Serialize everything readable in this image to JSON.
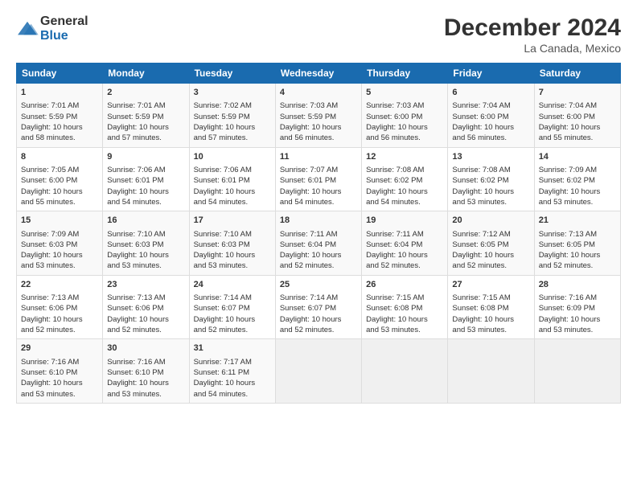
{
  "header": {
    "logo_text_general": "General",
    "logo_text_blue": "Blue",
    "main_title": "December 2024",
    "subtitle": "La Canada, Mexico"
  },
  "columns": [
    "Sunday",
    "Monday",
    "Tuesday",
    "Wednesday",
    "Thursday",
    "Friday",
    "Saturday"
  ],
  "weeks": [
    {
      "days": [
        {
          "num": "1",
          "sunrise": "7:01 AM",
          "sunset": "5:59 PM",
          "daylight": "10 hours and 58 minutes."
        },
        {
          "num": "2",
          "sunrise": "7:01 AM",
          "sunset": "5:59 PM",
          "daylight": "10 hours and 57 minutes."
        },
        {
          "num": "3",
          "sunrise": "7:02 AM",
          "sunset": "5:59 PM",
          "daylight": "10 hours and 57 minutes."
        },
        {
          "num": "4",
          "sunrise": "7:03 AM",
          "sunset": "5:59 PM",
          "daylight": "10 hours and 56 minutes."
        },
        {
          "num": "5",
          "sunrise": "7:03 AM",
          "sunset": "6:00 PM",
          "daylight": "10 hours and 56 minutes."
        },
        {
          "num": "6",
          "sunrise": "7:04 AM",
          "sunset": "6:00 PM",
          "daylight": "10 hours and 56 minutes."
        },
        {
          "num": "7",
          "sunrise": "7:04 AM",
          "sunset": "6:00 PM",
          "daylight": "10 hours and 55 minutes."
        }
      ]
    },
    {
      "days": [
        {
          "num": "8",
          "sunrise": "7:05 AM",
          "sunset": "6:00 PM",
          "daylight": "10 hours and 55 minutes."
        },
        {
          "num": "9",
          "sunrise": "7:06 AM",
          "sunset": "6:01 PM",
          "daylight": "10 hours and 54 minutes."
        },
        {
          "num": "10",
          "sunrise": "7:06 AM",
          "sunset": "6:01 PM",
          "daylight": "10 hours and 54 minutes."
        },
        {
          "num": "11",
          "sunrise": "7:07 AM",
          "sunset": "6:01 PM",
          "daylight": "10 hours and 54 minutes."
        },
        {
          "num": "12",
          "sunrise": "7:08 AM",
          "sunset": "6:02 PM",
          "daylight": "10 hours and 54 minutes."
        },
        {
          "num": "13",
          "sunrise": "7:08 AM",
          "sunset": "6:02 PM",
          "daylight": "10 hours and 53 minutes."
        },
        {
          "num": "14",
          "sunrise": "7:09 AM",
          "sunset": "6:02 PM",
          "daylight": "10 hours and 53 minutes."
        }
      ]
    },
    {
      "days": [
        {
          "num": "15",
          "sunrise": "7:09 AM",
          "sunset": "6:03 PM",
          "daylight": "10 hours and 53 minutes."
        },
        {
          "num": "16",
          "sunrise": "7:10 AM",
          "sunset": "6:03 PM",
          "daylight": "10 hours and 53 minutes."
        },
        {
          "num": "17",
          "sunrise": "7:10 AM",
          "sunset": "6:03 PM",
          "daylight": "10 hours and 53 minutes."
        },
        {
          "num": "18",
          "sunrise": "7:11 AM",
          "sunset": "6:04 PM",
          "daylight": "10 hours and 52 minutes."
        },
        {
          "num": "19",
          "sunrise": "7:11 AM",
          "sunset": "6:04 PM",
          "daylight": "10 hours and 52 minutes."
        },
        {
          "num": "20",
          "sunrise": "7:12 AM",
          "sunset": "6:05 PM",
          "daylight": "10 hours and 52 minutes."
        },
        {
          "num": "21",
          "sunrise": "7:13 AM",
          "sunset": "6:05 PM",
          "daylight": "10 hours and 52 minutes."
        }
      ]
    },
    {
      "days": [
        {
          "num": "22",
          "sunrise": "7:13 AM",
          "sunset": "6:06 PM",
          "daylight": "10 hours and 52 minutes."
        },
        {
          "num": "23",
          "sunrise": "7:13 AM",
          "sunset": "6:06 PM",
          "daylight": "10 hours and 52 minutes."
        },
        {
          "num": "24",
          "sunrise": "7:14 AM",
          "sunset": "6:07 PM",
          "daylight": "10 hours and 52 minutes."
        },
        {
          "num": "25",
          "sunrise": "7:14 AM",
          "sunset": "6:07 PM",
          "daylight": "10 hours and 52 minutes."
        },
        {
          "num": "26",
          "sunrise": "7:15 AM",
          "sunset": "6:08 PM",
          "daylight": "10 hours and 53 minutes."
        },
        {
          "num": "27",
          "sunrise": "7:15 AM",
          "sunset": "6:08 PM",
          "daylight": "10 hours and 53 minutes."
        },
        {
          "num": "28",
          "sunrise": "7:16 AM",
          "sunset": "6:09 PM",
          "daylight": "10 hours and 53 minutes."
        }
      ]
    },
    {
      "days": [
        {
          "num": "29",
          "sunrise": "7:16 AM",
          "sunset": "6:10 PM",
          "daylight": "10 hours and 53 minutes."
        },
        {
          "num": "30",
          "sunrise": "7:16 AM",
          "sunset": "6:10 PM",
          "daylight": "10 hours and 53 minutes."
        },
        {
          "num": "31",
          "sunrise": "7:17 AM",
          "sunset": "6:11 PM",
          "daylight": "10 hours and 54 minutes."
        },
        null,
        null,
        null,
        null
      ]
    }
  ],
  "labels": {
    "sunrise": "Sunrise:",
    "sunset": "Sunset:",
    "daylight": "Daylight:"
  }
}
